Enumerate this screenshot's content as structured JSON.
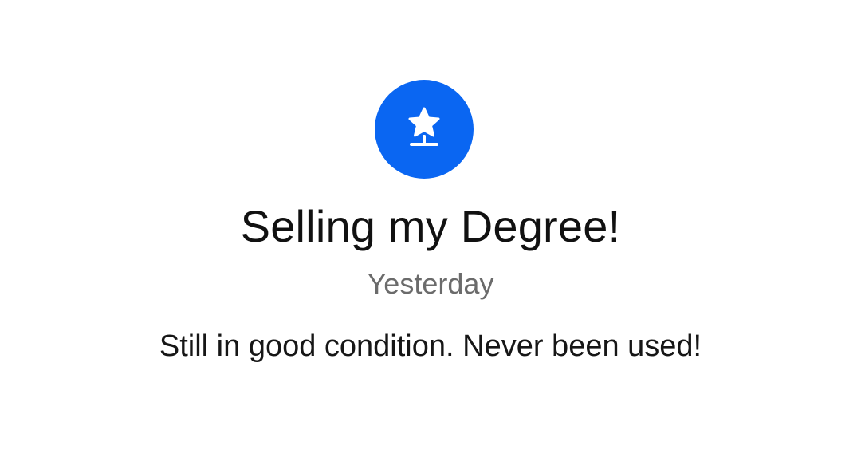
{
  "notification": {
    "icon": "star-sign-icon",
    "accent_color": "#0A66F2",
    "title": "Selling my Degree!",
    "timestamp": "Yesterday",
    "message": "Still in good condition. Never been used!"
  }
}
